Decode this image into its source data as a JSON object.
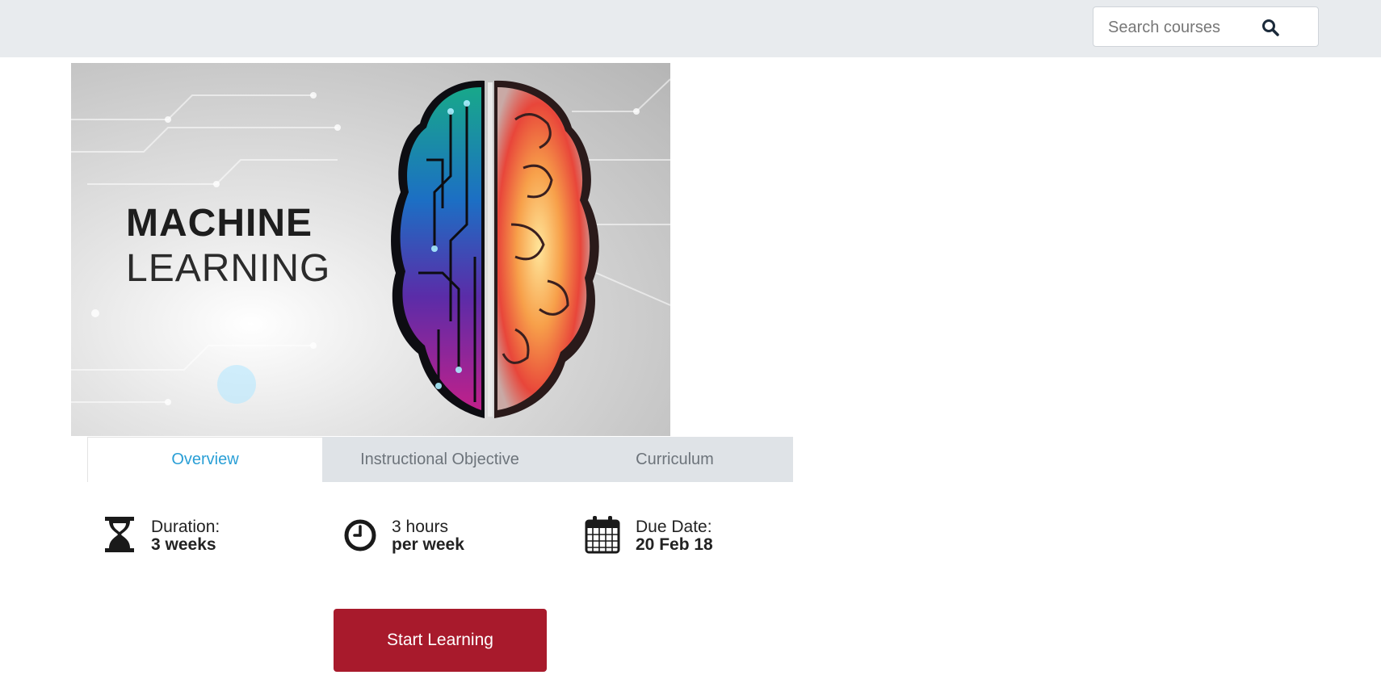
{
  "search": {
    "placeholder": "Search courses",
    "icon": "search-icon"
  },
  "hero": {
    "title_line1": "MACHINE",
    "title_line2": "LEARNING"
  },
  "tabs": [
    {
      "label": "Overview",
      "active": true
    },
    {
      "label": "Instructional Objective",
      "active": false
    },
    {
      "label": "Curriculum",
      "active": false
    }
  ],
  "meta": {
    "duration": {
      "label": "Duration:",
      "value": "3 weeks",
      "icon": "hourglass-icon"
    },
    "effort": {
      "label": "3 hours",
      "value": "per week",
      "icon": "clock-icon"
    },
    "due": {
      "label": "Due Date:",
      "value": "20 Feb 18",
      "icon": "calendar-icon"
    }
  },
  "actions": {
    "start_label": "Start Learning"
  },
  "colors": {
    "accent": "#2a9fd6",
    "primary_button": "#a81a2c",
    "topbar": "#e8ebee"
  }
}
